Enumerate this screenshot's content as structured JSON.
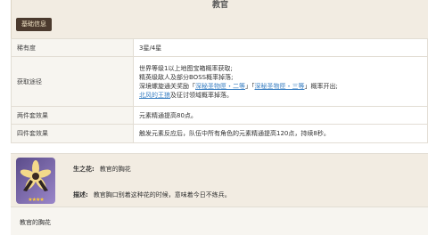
{
  "header": {
    "title": "教官",
    "tab_label": "基础信息"
  },
  "info_rows": {
    "rarity": {
      "label": "稀有度",
      "value": "3星/4星"
    },
    "source": {
      "label": "获取途径",
      "line1": "世界等级1以上地图宝箱概率获取;",
      "line2": "精英级敌人及部分BOSS概率掉落;",
      "line3_prefix": "深境螺旋通关奖励「",
      "link1": "深秘圣物匣・二等",
      "line3_mid": "」「",
      "link2": "深秘圣物匣・三等",
      "line3_suffix": "」概率开出;",
      "link3": "北风的王狼",
      "line4_suffix": "及征讨领域概率掉落。"
    },
    "two_piece": {
      "label": "两件套效果",
      "value": "元素精通提高80点。"
    },
    "four_piece": {
      "label": "四件套效果",
      "value": "触发元素反应后，队伍中所有角色的元素精通提高120点，持续8秒。"
    }
  },
  "item_card": {
    "slot_label": "生之花:",
    "slot_value": "教官的胸花",
    "desc_label": "描述:",
    "desc_value": "教官胸口别着这种花的时候，意味着今日不练兵。",
    "stars": "★★★★",
    "icon_name": "flower-icon"
  },
  "footer": {
    "item_name": "教官的胸花"
  }
}
